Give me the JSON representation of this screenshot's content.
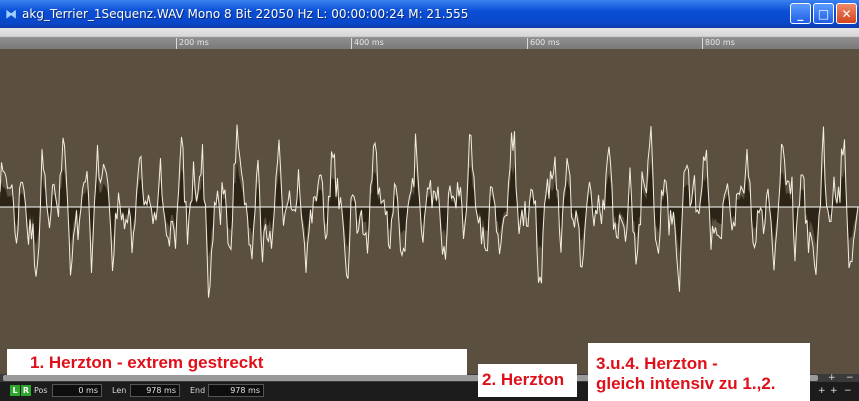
{
  "window": {
    "title": "akg_Terrier_1Sequenz.WAV  Mono 8 Bit 22050 Hz L: 00:00:00:24 M: 21.555",
    "buttons": {
      "minimize": "_",
      "maximize": "□",
      "close": "✕"
    }
  },
  "ruler": {
    "labels": [
      "200 ms",
      "400 ms",
      "600 ms",
      "800 ms"
    ]
  },
  "status": {
    "channel_l": "L",
    "channel_r": "R",
    "pos_label": "Pos",
    "pos_value": "0 ms",
    "len_label": "Len",
    "len_value": "978 ms",
    "end_label": "End",
    "end_value": "978 ms",
    "zoom_controls": [
      "+",
      "−",
      "+",
      "+",
      "−"
    ]
  },
  "annotations": {
    "first": "1. Herzton - extrem gestreckt",
    "second": "2. Herzton",
    "third_line1": "3.u.4. Herzton -",
    "third_line2": "gleich intensiv zu 1.,2."
  },
  "colors": {
    "background": "#5b5040",
    "waveform_line": "#f2ede0",
    "waveform_fill": "#2c2416",
    "annotation_text": "#e0101a"
  }
}
